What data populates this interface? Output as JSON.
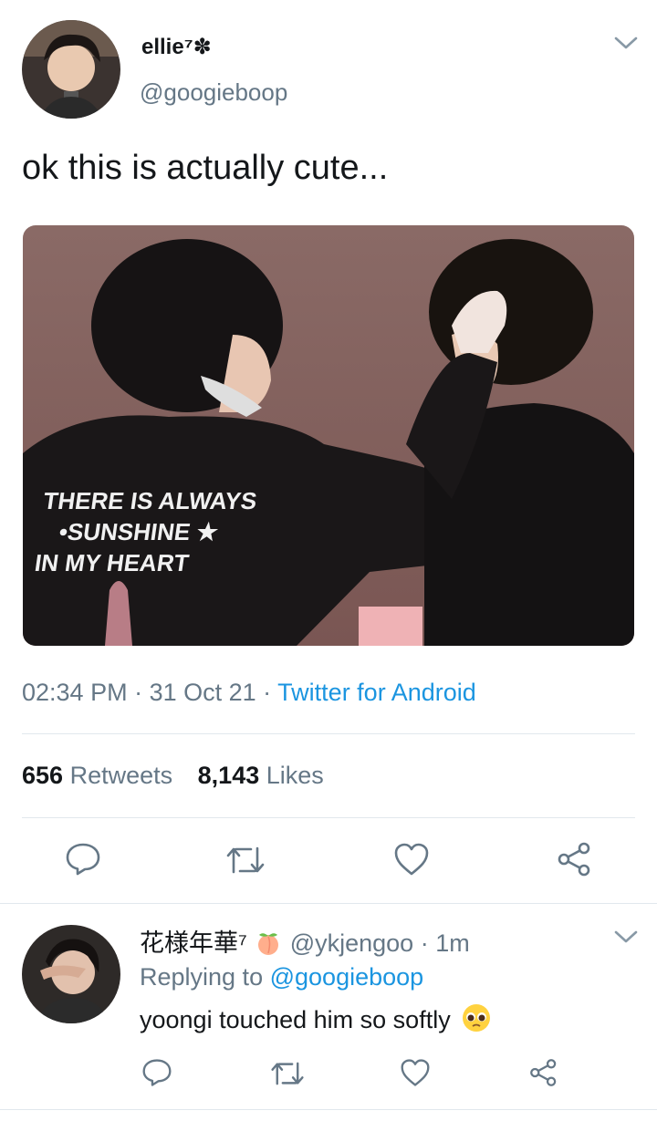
{
  "tweet": {
    "display_name": "ellie⁷",
    "handle": "@googieboop",
    "text": "ok this is actually cute...",
    "image_text": [
      "THERE IS ALWAYS",
      "SUNSHINE",
      "IN MY HEART"
    ],
    "time": "02:34 PM",
    "date": "31 Oct 21",
    "source": "Twitter for Android",
    "retweets_count": "656",
    "retweets_label": "Retweets",
    "likes_count": "8,143",
    "likes_label": "Likes"
  },
  "reply": {
    "display_name": "花様年華⁷",
    "handle": "@ykjengoo",
    "time": "1m",
    "replying_prefix": "Replying to",
    "replying_to": "@googieboop",
    "text": "yoongi touched him so softly"
  },
  "icons": {
    "reply": "speech-bubble-icon",
    "retweet": "retweet-icon",
    "like": "heart-icon",
    "share": "share-icon",
    "menu": "chevron-down-icon"
  },
  "colors": {
    "link": "#1b95e0",
    "secondary_text": "#657786",
    "divider": "#e1e8ed",
    "icon": "#657786"
  }
}
